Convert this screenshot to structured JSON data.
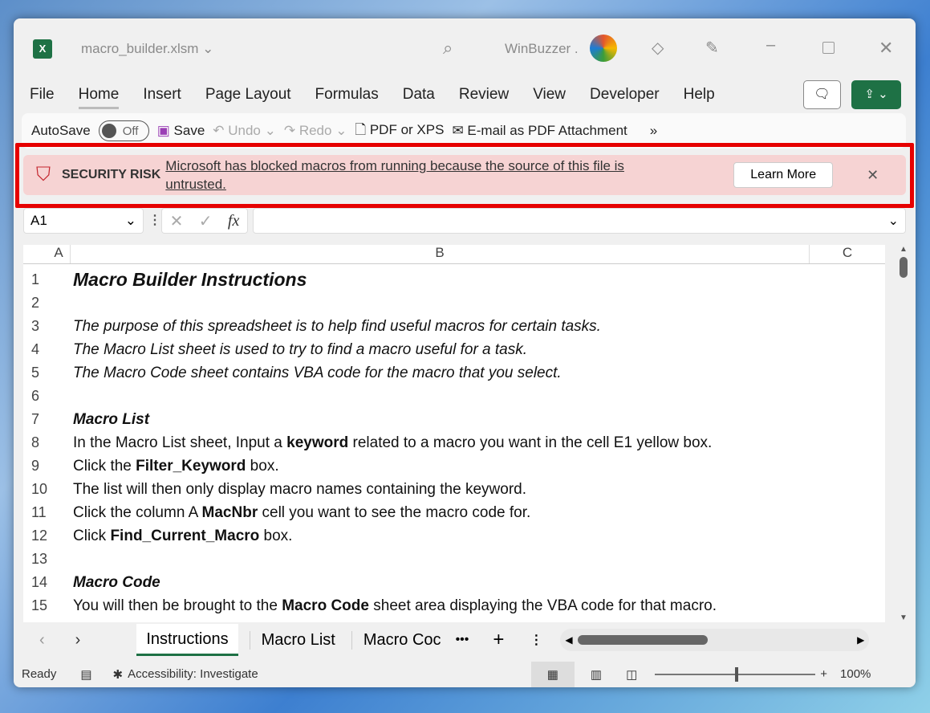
{
  "title": {
    "filename": "macro_builder.xlsm",
    "user": "WinBuzzer ."
  },
  "menu": [
    "File",
    "Home",
    "Insert",
    "Page Layout",
    "Formulas",
    "Data",
    "Review",
    "View",
    "Developer",
    "Help"
  ],
  "qat": {
    "autosave": "AutoSave",
    "toggle": "Off",
    "save": "Save",
    "undo": "Undo",
    "redo": "Redo",
    "pdf": "PDF or XPS",
    "email": "E-mail as PDF Attachment",
    "more": "»"
  },
  "security": {
    "label": "SECURITY RISK",
    "message": "Microsoft has blocked macros from running because the source of this file is untrusted.",
    "button": "Learn More"
  },
  "formula": {
    "namebox": "A1",
    "fx": "fx",
    "value": ""
  },
  "columns": [
    "A",
    "B",
    "C"
  ],
  "rows": [
    {
      "n": "1",
      "style": "title",
      "segs": [
        {
          "t": "Macro Builder Instructions"
        }
      ]
    },
    {
      "n": "2",
      "segs": []
    },
    {
      "n": "3",
      "style": "italic",
      "segs": [
        {
          "t": "The purpose of this spreadsheet is to help find useful macros for certain tasks."
        }
      ]
    },
    {
      "n": "4",
      "style": "italic",
      "segs": [
        {
          "t": "The Macro List sheet is used to try to find a macro useful for a task."
        }
      ]
    },
    {
      "n": "5",
      "style": "italic",
      "segs": [
        {
          "t": "The Macro Code sheet contains VBA code for the macro that you select."
        }
      ]
    },
    {
      "n": "6",
      "segs": []
    },
    {
      "n": "7",
      "style": "bi",
      "segs": [
        {
          "t": "Macro List"
        }
      ]
    },
    {
      "n": "8",
      "segs": [
        {
          "t": "In the Macro List sheet, Input a "
        },
        {
          "t": "keyword",
          "b": true
        },
        {
          "t": " related to a macro you want in the cell E1 yellow box."
        }
      ]
    },
    {
      "n": "9",
      "segs": [
        {
          "t": "Click the "
        },
        {
          "t": "Filter_Keyword",
          "b": true
        },
        {
          "t": " box."
        }
      ]
    },
    {
      "n": "10",
      "segs": [
        {
          "t": "The list will then only display macro names containing the keyword."
        }
      ]
    },
    {
      "n": "11",
      "segs": [
        {
          "t": "Click the column A "
        },
        {
          "t": "MacNbr",
          "b": true
        },
        {
          "t": " cell you want to see the macro code for."
        }
      ]
    },
    {
      "n": "12",
      "segs": [
        {
          "t": "Click "
        },
        {
          "t": "Find_Current_Macro",
          "b": true
        },
        {
          "t": " box."
        }
      ]
    },
    {
      "n": "13",
      "segs": []
    },
    {
      "n": "14",
      "style": "bi",
      "segs": [
        {
          "t": "Macro Code"
        }
      ]
    },
    {
      "n": "15",
      "segs": [
        {
          "t": "You will then be brought to the "
        },
        {
          "t": "Macro Code",
          "b": true
        },
        {
          "t": " sheet area displaying the VBA code for that macro."
        }
      ]
    }
  ],
  "sheets": [
    "Instructions",
    "Macro List",
    "Macro Coc"
  ],
  "status": {
    "ready": "Ready",
    "accessibility": "Accessibility: Investigate",
    "zoom": "100%"
  },
  "colors": {
    "excel_green": "#1e7145",
    "security_bg": "#f6d3d3",
    "highlight": "#e60000"
  }
}
